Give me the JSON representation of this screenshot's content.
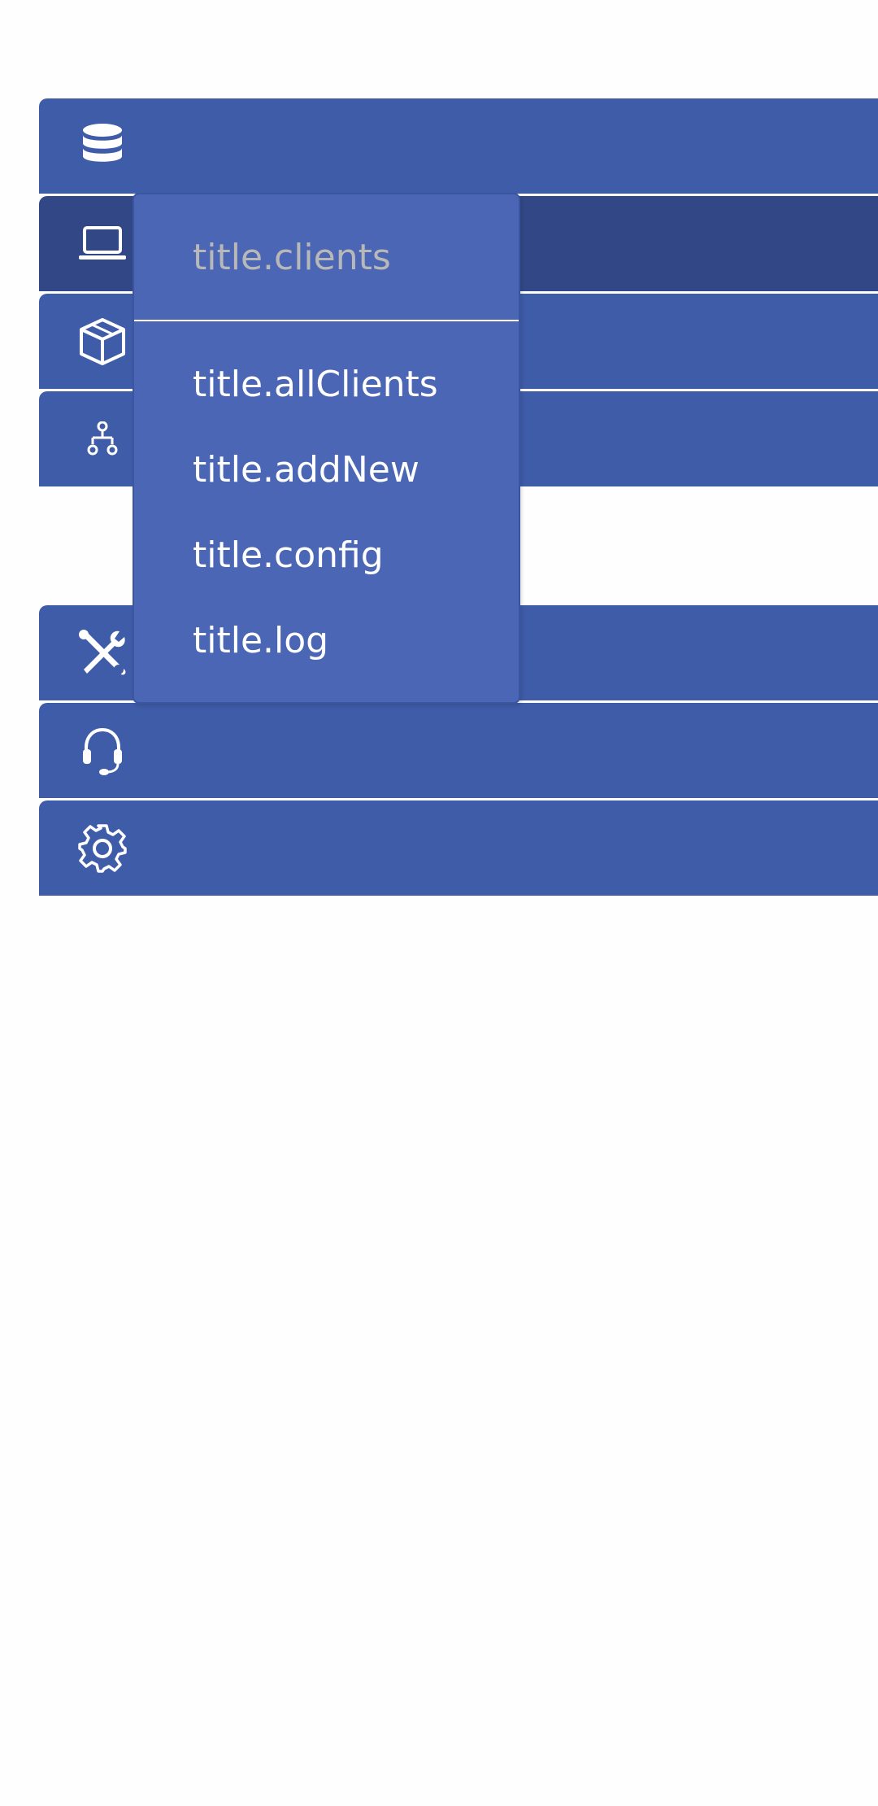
{
  "theme": {
    "sidebar_bg": "#3f5ca8",
    "sidebar_active_bg": "#324886",
    "dropdown_bg": "#4a66b4",
    "dropdown_title_color": "#b8b8b8",
    "text_color": "#ffffff"
  },
  "sidebar": {
    "top_items": [
      {
        "icon": "database-icon",
        "active": false
      },
      {
        "icon": "laptop-icon",
        "active": true
      },
      {
        "icon": "box-icon",
        "active": false
      },
      {
        "icon": "sitemap-icon",
        "active": false
      }
    ],
    "bottom_items": [
      {
        "icon": "tools-icon",
        "active": false
      },
      {
        "icon": "headset-icon",
        "active": false
      },
      {
        "icon": "gear-icon",
        "active": false
      }
    ]
  },
  "dropdown": {
    "title": "title.clients",
    "items": [
      {
        "label": "title.allClients"
      },
      {
        "label": "title.addNew"
      },
      {
        "label": "title.config"
      },
      {
        "label": "title.log"
      }
    ]
  }
}
